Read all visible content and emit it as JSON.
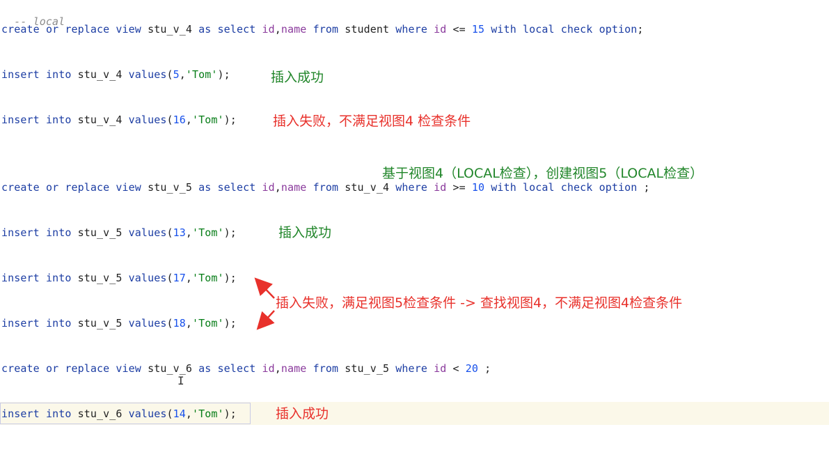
{
  "comment": "-- local",
  "lines": [
    {
      "name": "create-view-stu-v4",
      "tokens": [
        {
          "t": "create",
          "c": "kw"
        },
        {
          "t": " "
        },
        {
          "t": "or",
          "c": "kw"
        },
        {
          "t": " "
        },
        {
          "t": "replace",
          "c": "kw"
        },
        {
          "t": " "
        },
        {
          "t": "view",
          "c": "kw"
        },
        {
          "t": " "
        },
        {
          "t": "stu_v_4",
          "c": "id"
        },
        {
          "t": " "
        },
        {
          "t": "as",
          "c": "kw"
        },
        {
          "t": " "
        },
        {
          "t": "select",
          "c": "kw"
        },
        {
          "t": " "
        },
        {
          "t": "id",
          "c": "col"
        },
        {
          "t": ","
        },
        {
          "t": "name",
          "c": "col"
        },
        {
          "t": " "
        },
        {
          "t": "from",
          "c": "kw"
        },
        {
          "t": " "
        },
        {
          "t": "student",
          "c": "id"
        },
        {
          "t": " "
        },
        {
          "t": "where",
          "c": "kw"
        },
        {
          "t": " "
        },
        {
          "t": "id",
          "c": "col"
        },
        {
          "t": " <= "
        },
        {
          "t": "15",
          "c": "num"
        },
        {
          "t": " "
        },
        {
          "t": "with",
          "c": "kw"
        },
        {
          "t": " "
        },
        {
          "t": "local",
          "c": "kw"
        },
        {
          "t": " "
        },
        {
          "t": "check",
          "c": "kw"
        },
        {
          "t": " "
        },
        {
          "t": "option",
          "c": "kw"
        },
        {
          "t": ";"
        }
      ]
    },
    {
      "name": "insert-stu-v4-5",
      "tokens": [
        {
          "t": "insert",
          "c": "kw"
        },
        {
          "t": " "
        },
        {
          "t": "into",
          "c": "kw"
        },
        {
          "t": " "
        },
        {
          "t": "stu_v_4",
          "c": "id"
        },
        {
          "t": " "
        },
        {
          "t": "values",
          "c": "fn"
        },
        {
          "t": "("
        },
        {
          "t": "5",
          "c": "num"
        },
        {
          "t": ","
        },
        {
          "t": "'Tom'",
          "c": "str"
        },
        {
          "t": ");"
        }
      ]
    },
    {
      "name": "insert-stu-v4-16",
      "tokens": [
        {
          "t": "insert",
          "c": "kw"
        },
        {
          "t": " "
        },
        {
          "t": "into",
          "c": "kw"
        },
        {
          "t": " "
        },
        {
          "t": "stu_v_4",
          "c": "id"
        },
        {
          "t": " "
        },
        {
          "t": "values",
          "c": "fn"
        },
        {
          "t": "("
        },
        {
          "t": "16",
          "c": "num"
        },
        {
          "t": ","
        },
        {
          "t": "'Tom'",
          "c": "str"
        },
        {
          "t": ");"
        }
      ]
    },
    {
      "name": "create-view-stu-v5",
      "tokens": [
        {
          "t": "create",
          "c": "kw"
        },
        {
          "t": " "
        },
        {
          "t": "or",
          "c": "kw"
        },
        {
          "t": " "
        },
        {
          "t": "replace",
          "c": "kw"
        },
        {
          "t": " "
        },
        {
          "t": "view",
          "c": "kw"
        },
        {
          "t": " "
        },
        {
          "t": "stu_v_5",
          "c": "id"
        },
        {
          "t": " "
        },
        {
          "t": "as",
          "c": "kw"
        },
        {
          "t": " "
        },
        {
          "t": "select",
          "c": "kw"
        },
        {
          "t": " "
        },
        {
          "t": "id",
          "c": "col"
        },
        {
          "t": ","
        },
        {
          "t": "name",
          "c": "col"
        },
        {
          "t": " "
        },
        {
          "t": "from",
          "c": "kw"
        },
        {
          "t": " "
        },
        {
          "t": "stu_v_4",
          "c": "id"
        },
        {
          "t": " "
        },
        {
          "t": "where",
          "c": "kw"
        },
        {
          "t": " "
        },
        {
          "t": "id",
          "c": "col"
        },
        {
          "t": " >= "
        },
        {
          "t": "10",
          "c": "num"
        },
        {
          "t": " "
        },
        {
          "t": "with",
          "c": "kw"
        },
        {
          "t": " "
        },
        {
          "t": "local",
          "c": "kw"
        },
        {
          "t": " "
        },
        {
          "t": "check",
          "c": "kw"
        },
        {
          "t": " "
        },
        {
          "t": "option",
          "c": "kw"
        },
        {
          "t": " ;"
        }
      ]
    },
    {
      "name": "insert-stu-v5-13",
      "tokens": [
        {
          "t": "insert",
          "c": "kw"
        },
        {
          "t": " "
        },
        {
          "t": "into",
          "c": "kw"
        },
        {
          "t": " "
        },
        {
          "t": "stu_v_5",
          "c": "id"
        },
        {
          "t": " "
        },
        {
          "t": "values",
          "c": "fn"
        },
        {
          "t": "("
        },
        {
          "t": "13",
          "c": "num"
        },
        {
          "t": ","
        },
        {
          "t": "'Tom'",
          "c": "str"
        },
        {
          "t": ");"
        }
      ]
    },
    {
      "name": "insert-stu-v5-17",
      "tokens": [
        {
          "t": "insert",
          "c": "kw"
        },
        {
          "t": " "
        },
        {
          "t": "into",
          "c": "kw"
        },
        {
          "t": " "
        },
        {
          "t": "stu_v_5",
          "c": "id"
        },
        {
          "t": " "
        },
        {
          "t": "values",
          "c": "fn"
        },
        {
          "t": "("
        },
        {
          "t": "17",
          "c": "num"
        },
        {
          "t": ","
        },
        {
          "t": "'Tom'",
          "c": "str"
        },
        {
          "t": ");"
        }
      ]
    },
    {
      "name": "insert-stu-v5-18",
      "tokens": [
        {
          "t": "insert",
          "c": "kw"
        },
        {
          "t": " "
        },
        {
          "t": "into",
          "c": "kw"
        },
        {
          "t": " "
        },
        {
          "t": "stu_v_5",
          "c": "id"
        },
        {
          "t": " "
        },
        {
          "t": "values",
          "c": "fn"
        },
        {
          "t": "("
        },
        {
          "t": "18",
          "c": "num"
        },
        {
          "t": ","
        },
        {
          "t": "'Tom'",
          "c": "str"
        },
        {
          "t": ");"
        }
      ]
    },
    {
      "name": "create-view-stu-v6",
      "tokens": [
        {
          "t": "create",
          "c": "kw"
        },
        {
          "t": " "
        },
        {
          "t": "or",
          "c": "kw"
        },
        {
          "t": " "
        },
        {
          "t": "replace",
          "c": "kw"
        },
        {
          "t": " "
        },
        {
          "t": "view",
          "c": "kw"
        },
        {
          "t": " "
        },
        {
          "t": "stu_v_6",
          "c": "id"
        },
        {
          "t": " "
        },
        {
          "t": "as",
          "c": "kw"
        },
        {
          "t": " "
        },
        {
          "t": "select",
          "c": "kw"
        },
        {
          "t": " "
        },
        {
          "t": "id",
          "c": "col"
        },
        {
          "t": ","
        },
        {
          "t": "name",
          "c": "col"
        },
        {
          "t": " "
        },
        {
          "t": "from",
          "c": "kw"
        },
        {
          "t": " "
        },
        {
          "t": "stu_v_5",
          "c": "id"
        },
        {
          "t": " "
        },
        {
          "t": "where",
          "c": "kw"
        },
        {
          "t": " "
        },
        {
          "t": "id",
          "c": "col"
        },
        {
          "t": " < "
        },
        {
          "t": "20",
          "c": "num"
        },
        {
          "t": " ;"
        }
      ]
    },
    {
      "name": "insert-stu-v6-14",
      "tokens": [
        {
          "t": "insert",
          "c": "kw"
        },
        {
          "t": " "
        },
        {
          "t": "into",
          "c": "kw"
        },
        {
          "t": " "
        },
        {
          "t": "stu_v_6",
          "c": "id"
        },
        {
          "t": " "
        },
        {
          "t": "values",
          "c": "fn"
        },
        {
          "t": "("
        },
        {
          "t": "14",
          "c": "num"
        },
        {
          "t": ","
        },
        {
          "t": "'Tom'",
          "c": "str"
        },
        {
          "t": ");"
        }
      ]
    }
  ],
  "notes": {
    "v4_insert_5": "插入成功",
    "v4_insert_16": "插入失败，不满足视图4 检查条件",
    "v5_header": "基于视图4（LOCAL检查），创建视图5（LOCAL检查）",
    "v5_insert_13": "插入成功",
    "v5_insert_17_18": "插入失败，满足视图5检查条件 -> 查找视图4，不满足视图4检查条件",
    "v6_insert_14": "插入成功"
  },
  "colors": {
    "success_note": "#21862a",
    "failure_note": "#e8312b",
    "arrow": "#e8312b",
    "current_line_bg": "#fbf8e9"
  }
}
